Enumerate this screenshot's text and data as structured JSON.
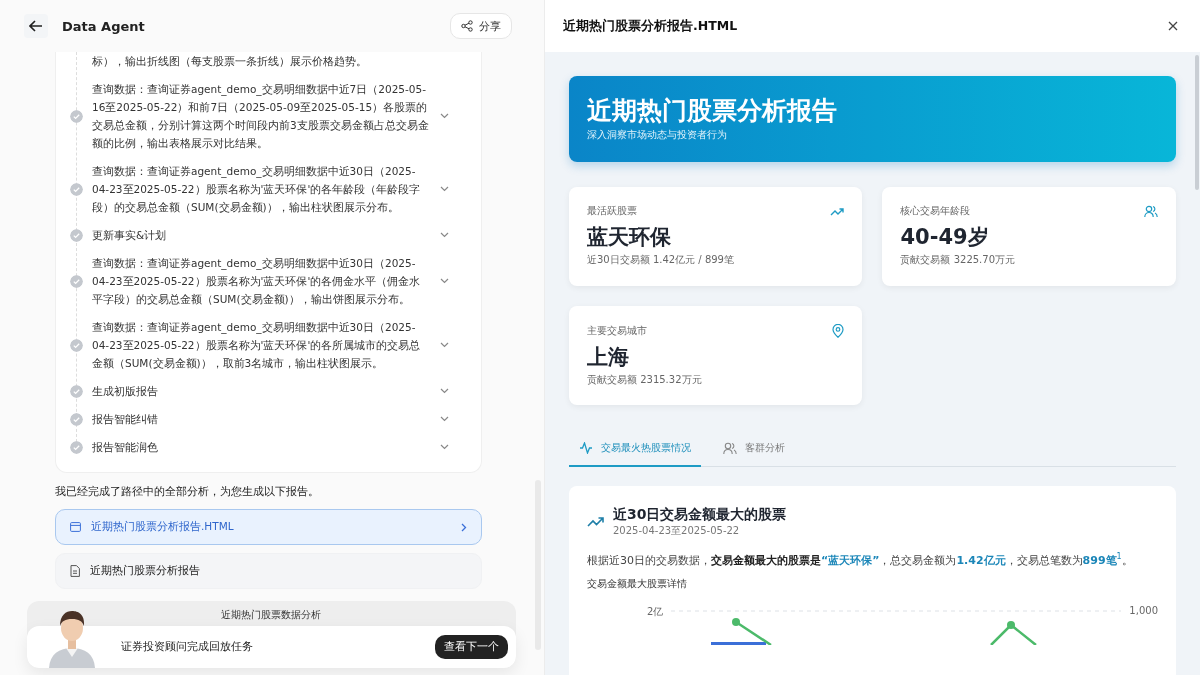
{
  "header": {
    "title": "Data Agent",
    "share": "分享"
  },
  "steps": [
    {
      "kind": "continued",
      "text": "标），输出折线图（每支股票一条折线）展示价格趋势。"
    },
    {
      "kind": "step",
      "text": "查询数据：查询证券agent_demo_交易明细数据中近7日（2025-05-16至2025-05-22）和前7日（2025-05-09至2025-05-15）各股票的交易总金额，分别计算这两个时间段内前3支股票交易金额占总交易金额的比例，输出表格展示对比结果。"
    },
    {
      "kind": "step",
      "text": "查询数据：查询证券agent_demo_交易明细数据中近30日（2025-04-23至2025-05-22）股票名称为'蓝天环保'的各年龄段（年龄段字段）的交易总金额（SUM(交易金额)），输出柱状图展示分布。"
    },
    {
      "kind": "step",
      "text": "更新事实&计划"
    },
    {
      "kind": "step",
      "text": "查询数据：查询证券agent_demo_交易明细数据中近30日（2025-04-23至2025-05-22）股票名称为'蓝天环保'的各佣金水平（佣金水平字段）的交易总金额（SUM(交易金额)），输出饼图展示分布。"
    },
    {
      "kind": "step",
      "text": "查询数据：查询证券agent_demo_交易明细数据中近30日（2025-04-23至2025-05-22）股票名称为'蓝天环保'的各所属城市的交易总金额（SUM(交易金额)），取前3名城市，输出柱状图展示。"
    },
    {
      "kind": "step",
      "text": "生成初版报告"
    },
    {
      "kind": "step",
      "text": "报告智能纠错"
    },
    {
      "kind": "step",
      "text": "报告智能润色"
    }
  ],
  "summary": "我已经完成了路径中的全部分析，为您生成以下报告。",
  "files": [
    {
      "kind": "html",
      "name": "近期热门股票分析报告.HTML",
      "selected": true
    },
    {
      "kind": "doc",
      "name": "近期热门股票分析报告",
      "selected": false
    }
  ],
  "player": {
    "title": "近期热门股票数据分析",
    "message": "证券投资顾问完成回放任务",
    "button": "查看下一个"
  },
  "preview": {
    "title": "近期热门股票分析报告.HTML",
    "banner": {
      "title": "近期热门股票分析报告",
      "subtitle": "深入洞察市场动态与投资者行为"
    },
    "stats": [
      {
        "label": "最活跃股票",
        "value": "蓝天环保",
        "note": "近30日交易额 1.42亿元 / 899笔"
      },
      {
        "label": "核心交易年龄段",
        "value": "40-49岁",
        "note": "贡献交易额 3225.70万元"
      },
      {
        "label": "主要交易城市",
        "value": "上海",
        "note": "贡献交易额 2315.32万元"
      }
    ],
    "tabs": [
      {
        "label": "交易最火热股票情况",
        "selected": true
      },
      {
        "label": "客群分析",
        "selected": false
      }
    ],
    "section": {
      "title": "近30日交易金额最大的股票",
      "date": "2025-04-23至2025-05-22",
      "paragraph": [
        {
          "kind": "plain",
          "text": "根据近30日的交易数据，"
        },
        {
          "kind": "bold",
          "text": "交易金额最大的股票是"
        },
        {
          "kind": "accent",
          "text": "“蓝天环保”"
        },
        {
          "kind": "plain",
          "text": "，总交易金额为"
        },
        {
          "kind": "accent",
          "text": "1.42亿元"
        },
        {
          "kind": "plain",
          "text": "，交易总笔数为"
        },
        {
          "kind": "accent",
          "text": "899笔"
        },
        {
          "kind": "note",
          "text": "1"
        },
        {
          "kind": "plain",
          "text": "。"
        }
      ],
      "chart_title": "交易金额最大股票详情",
      "left_tick": "2亿",
      "right_tick": "1,000"
    }
  }
}
